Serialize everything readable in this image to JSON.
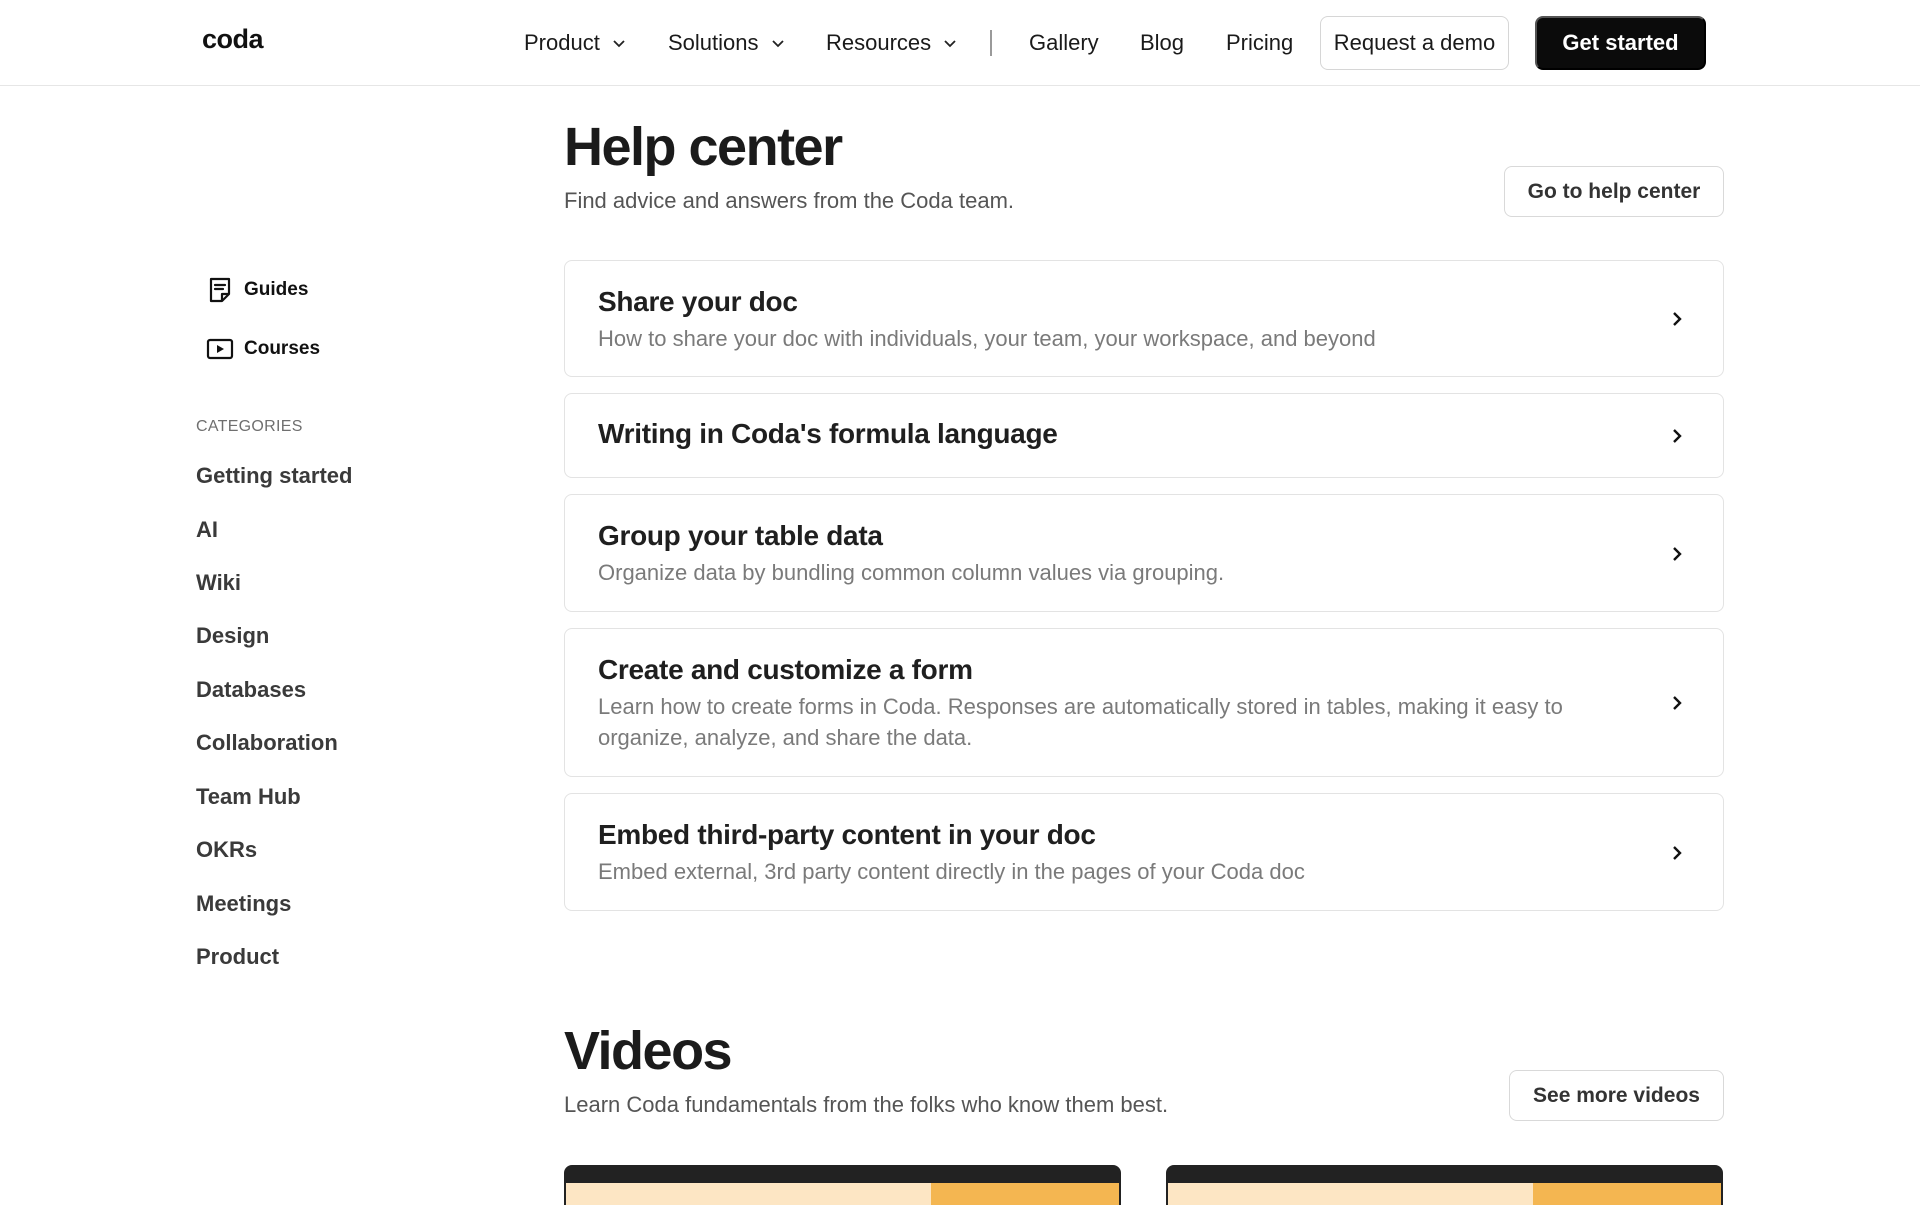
{
  "nav": {
    "logo": "coda",
    "items": [
      {
        "label": "Product",
        "dropdown": true
      },
      {
        "label": "Solutions",
        "dropdown": true
      },
      {
        "label": "Resources",
        "dropdown": true
      },
      {
        "label": "Gallery",
        "dropdown": false
      },
      {
        "label": "Blog",
        "dropdown": false
      },
      {
        "label": "Pricing",
        "dropdown": false
      }
    ],
    "request_demo": "Request a demo",
    "get_started": "Get started"
  },
  "sidebar": {
    "links": [
      {
        "label": "Guides",
        "icon": "guide-icon"
      },
      {
        "label": "Courses",
        "icon": "play-icon"
      }
    ],
    "categories_heading": "CATEGORIES",
    "categories": [
      "Getting started",
      "AI",
      "Wiki",
      "Design",
      "Databases",
      "Collaboration",
      "Team Hub",
      "OKRs",
      "Meetings",
      "Product"
    ]
  },
  "help": {
    "title": "Help center",
    "subtitle": "Find advice and answers from the Coda team.",
    "button": "Go to help center",
    "articles": [
      {
        "title": "Share your doc",
        "desc": "How to share your doc with individuals, your team, your workspace, and beyond"
      },
      {
        "title": "Writing in Coda's formula language",
        "desc": ""
      },
      {
        "title": "Group your table data",
        "desc": "Organize data by bundling common column values via grouping."
      },
      {
        "title": "Create and customize a form",
        "desc": "Learn how to create forms in Coda. Responses are automatically stored in tables, making it easy to organize, analyze, and share the data."
      },
      {
        "title": "Embed third-party content in your doc",
        "desc": "Embed external, 3rd party content directly in the pages of your Coda doc"
      }
    ]
  },
  "videos": {
    "title": "Videos",
    "subtitle": "Learn Coda fundamentals from the folks who know them best.",
    "button": "See more videos"
  },
  "colors": {
    "accent": "#0b0b0b",
    "thumb_light": "#fde6c4",
    "thumb_dark": "#f4b651"
  }
}
